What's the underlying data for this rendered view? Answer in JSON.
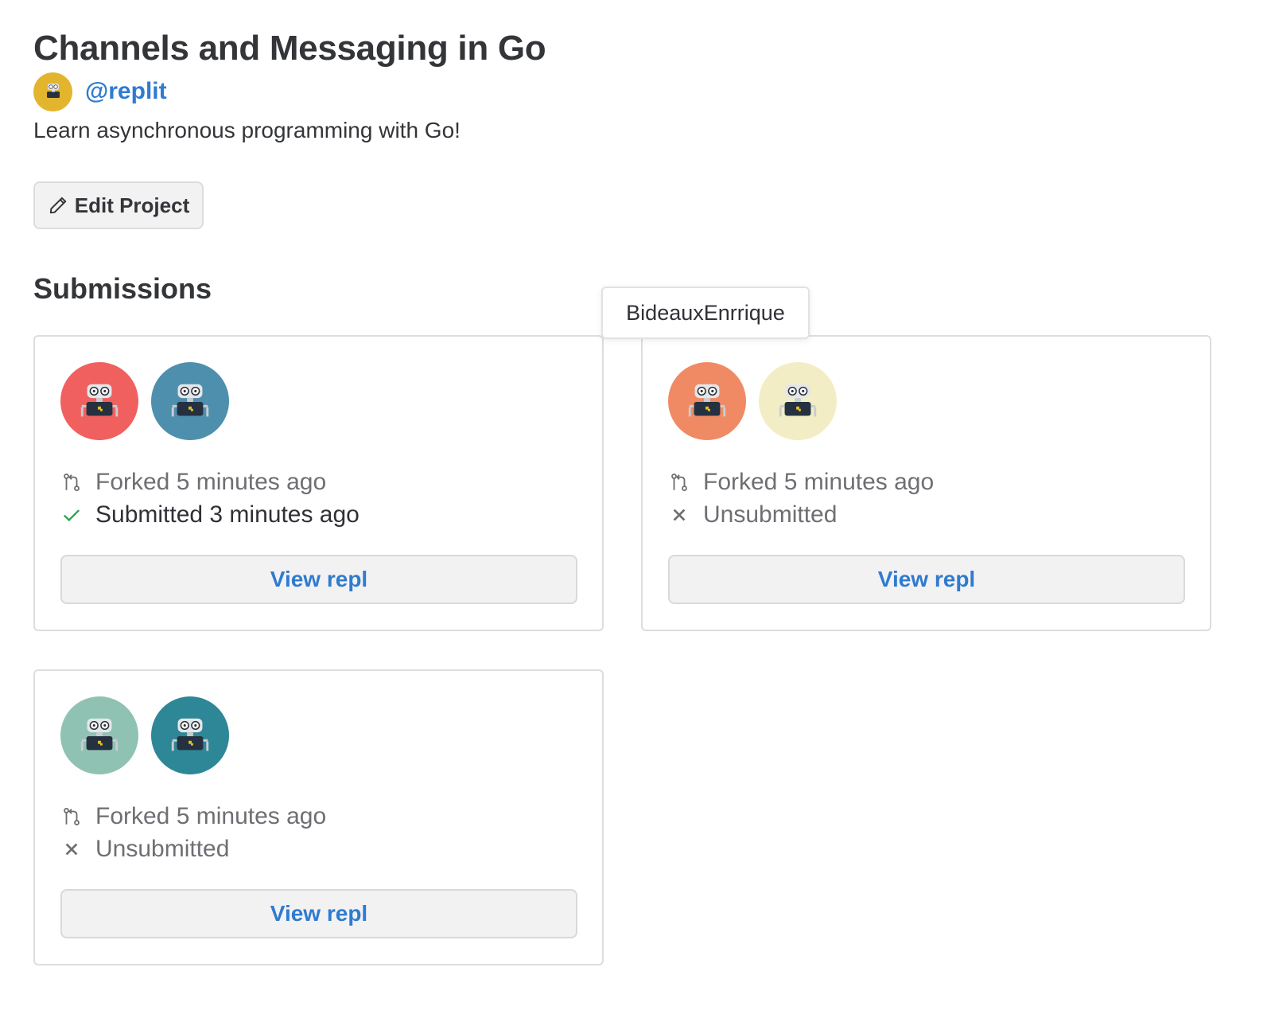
{
  "project": {
    "title": "Channels and Messaging in Go",
    "author": "@replit",
    "description": "Learn asynchronous programming with Go!",
    "edit_label": "Edit Project"
  },
  "submissions": {
    "heading": "Submissions",
    "tooltip": "BideauxEnrrique",
    "cards": [
      {
        "avatar_colors": [
          "#f0605f",
          "#4f8fae"
        ],
        "forked": "Forked 5 minutes ago",
        "status": "Submitted 3 minutes ago",
        "status_icon": "check-icon",
        "view_label": "View repl"
      },
      {
        "avatar_colors": [
          "#f08a64",
          "#f2edc4"
        ],
        "forked": "Forked 5 minutes ago",
        "status": "Unsubmitted",
        "status_icon": "x-icon",
        "view_label": "View repl"
      },
      {
        "avatar_colors": [
          "#8fc2b3",
          "#2e8796"
        ],
        "forked": "Forked 5 minutes ago",
        "status": "Unsubmitted",
        "status_icon": "x-icon",
        "view_label": "View repl"
      }
    ]
  },
  "colors": {
    "link": "#2f7bd0",
    "check": "#2ea44f",
    "author_avatar": "#e3b52e"
  }
}
